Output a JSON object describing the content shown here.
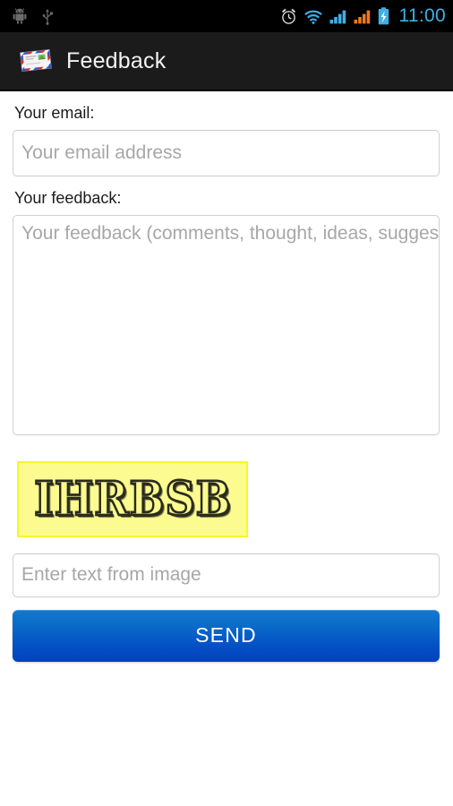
{
  "status_bar": {
    "left_icons": [
      {
        "name": "android-debug-icon",
        "label": "android-debug"
      },
      {
        "name": "usb-icon",
        "label": "usb"
      }
    ],
    "right_icons": [
      {
        "name": "alarm-clock-icon",
        "label": "alarm"
      },
      {
        "name": "wifi-icon",
        "label": "wifi"
      },
      {
        "name": "signal-sim1-icon",
        "label": "signal-sim1"
      },
      {
        "name": "signal-sim2-icon",
        "label": "signal-sim2"
      },
      {
        "name": "battery-charging-icon",
        "label": "battery-charging"
      }
    ],
    "time": "11:00",
    "time_color": "#3eb0e8",
    "background": "#000000"
  },
  "action_bar": {
    "icon": "envelope-mail-icon",
    "title": "Feedback",
    "background": "#1b1b1b",
    "title_color": "#f2f2f2"
  },
  "form": {
    "email": {
      "label": "Your email:",
      "placeholder": "Your email address",
      "value": ""
    },
    "feedback": {
      "label": "Your feedback:",
      "placeholder": "Your feedback (comments, thought, ideas, suggestions)",
      "value": ""
    },
    "captcha": {
      "image_text": "IHRBSB",
      "image_background": "#fbfb8f",
      "image_border": "#f7f72a",
      "input_placeholder": "Enter text from image",
      "input_value": ""
    },
    "submit": {
      "label": "SEND",
      "gradient_top": "#1279cf",
      "gradient_bottom": "#0340bf",
      "text_color": "#ffffff"
    }
  }
}
